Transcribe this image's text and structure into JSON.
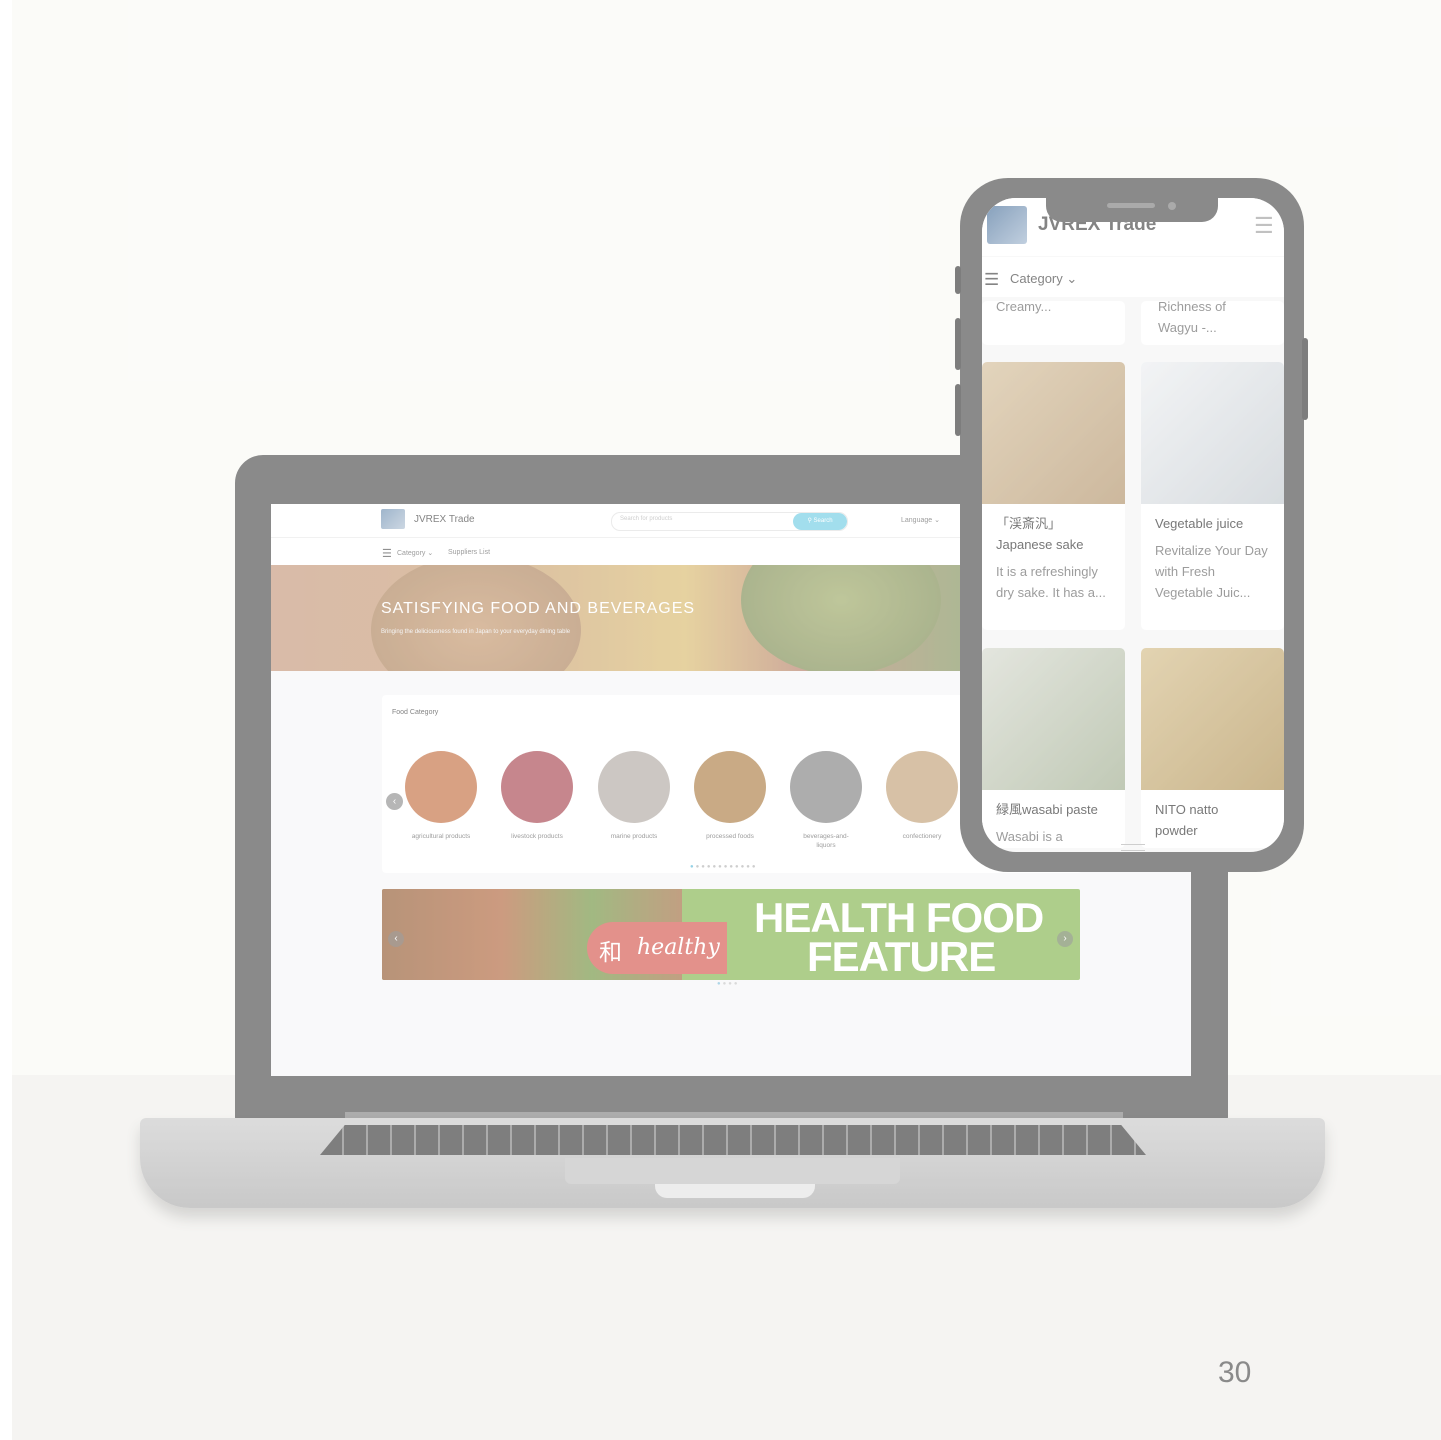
{
  "page_number": "30",
  "laptop_site": {
    "brand": "JVREX Trade",
    "search_placeholder": "Search for products",
    "search_button": "Search",
    "language": "Language",
    "nav": {
      "category": "Category",
      "suppliers": "Suppliers List"
    },
    "hero": {
      "title": "SATISFYING FOOD AND BEVERAGES",
      "subtitle": "Bringing the deliciousness found in Japan to your everyday dining table"
    },
    "food_category": {
      "heading": "Food Category",
      "items": [
        {
          "label": "agricultural products",
          "color": "#c97d54"
        },
        {
          "label": "livestock products",
          "color": "#b05861"
        },
        {
          "label": "marine products",
          "color": "#b9b2ac"
        },
        {
          "label": "processed foods",
          "color": "#b48a56"
        },
        {
          "label": "beverages-and-liquors",
          "color": "#8e8e8e"
        },
        {
          "label": "confectionery",
          "color": "#c8aa84"
        }
      ]
    },
    "promo": {
      "jp": "和",
      "healthy": "healthy",
      "line1": "HEALTH FOOD",
      "line2": "FEATURE"
    }
  },
  "phone_site": {
    "brand": "JVREX Trade",
    "category": "Category",
    "top_partial": {
      "left": "Creamy...",
      "right": "Richness of Wagyu -..."
    },
    "products": [
      {
        "name": "「渓斎汎」 Japanese sake",
        "desc": "It is a refreshingly dry sake. It has a...",
        "color": "#c9b496"
      },
      {
        "name": "Vegetable juice",
        "desc": "Revitalize Your Day with Fresh Vegetable Juic...",
        "color": "#dfe2e6"
      },
      {
        "name": "緑風wasabi paste",
        "desc": "Wasabi is a",
        "color": "#cfd2c8"
      },
      {
        "name": "NITO natto powder",
        "desc": "",
        "color": "#c9b07e"
      }
    ]
  }
}
